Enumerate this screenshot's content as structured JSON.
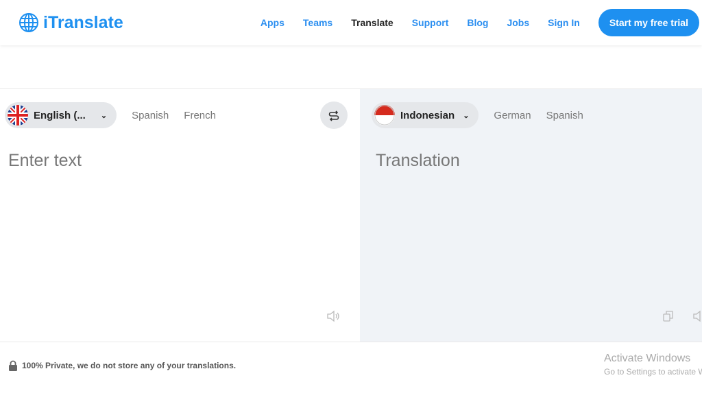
{
  "header": {
    "logo": "iTranslate",
    "nav": [
      "Apps",
      "Teams",
      "Translate",
      "Support",
      "Blog",
      "Jobs",
      "Sign In"
    ],
    "active": "Translate",
    "cta": "Start my free trial",
    "accent": "#1e90f0"
  },
  "source": {
    "selected": "English (...",
    "options": [
      "Spanish",
      "French"
    ],
    "placeholder": "Enter text"
  },
  "target": {
    "selected": "Indonesian",
    "options": [
      "German",
      "Spanish"
    ],
    "placeholder": "Translation"
  },
  "footer": {
    "privacy": "100% Private, we do not store any of your translations."
  },
  "watermark": {
    "title": "Activate Windows",
    "subtitle": "Go to Settings to activate Windows."
  }
}
